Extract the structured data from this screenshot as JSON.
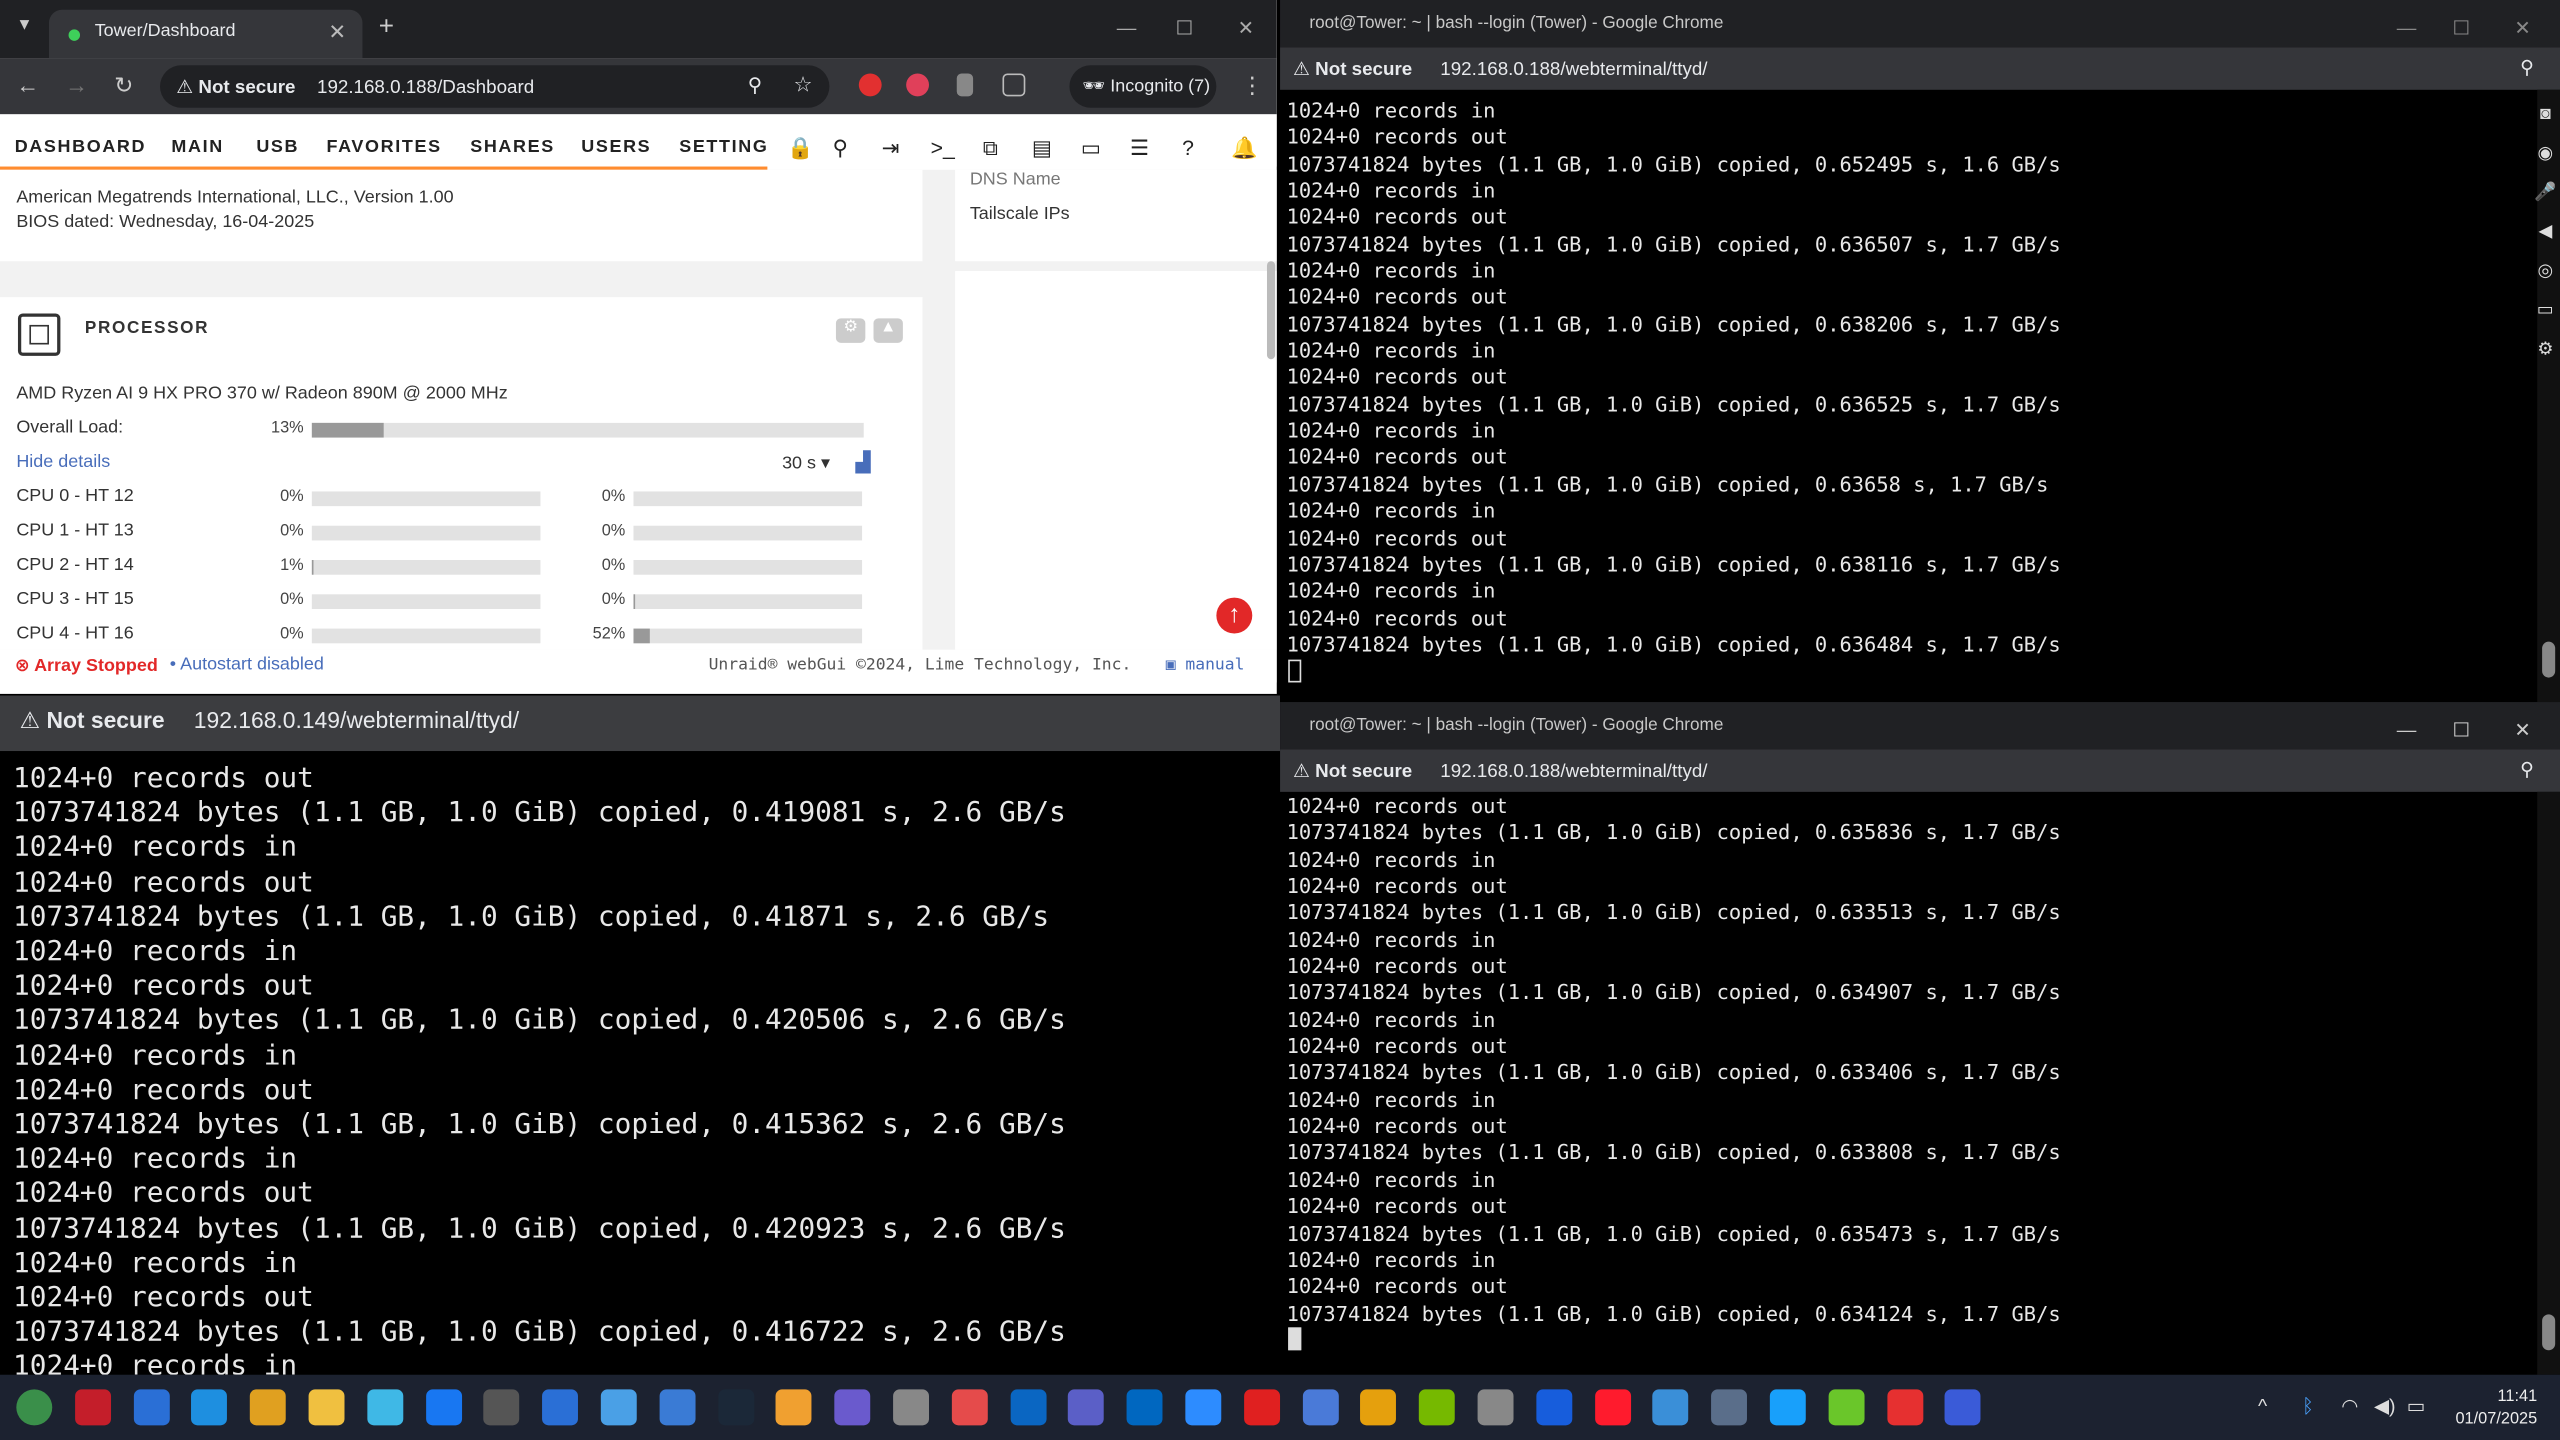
{
  "win1": {
    "tab_title": "Tower/Dashboard",
    "not_secure": "Not secure",
    "url": "192.168.0.188/Dashboard",
    "incognito": "Incognito (7)",
    "nav": [
      "DASHBOARD",
      "MAIN",
      "USB",
      "FAVORITES",
      "SHARES",
      "USERS",
      "SETTING"
    ],
    "bios_line1": "American Megatrends International, LLC., Version 1.00",
    "bios_line2": "BIOS dated: Wednesday, 16-04-2025",
    "right_dns": "DNS Name",
    "right_tailscale": "Tailscale IPs",
    "processor_title": "PROCESSOR",
    "cpu_model": "AMD Ryzen AI 9 HX PRO 370 w/ Radeon 890M @ 2000 MHz",
    "overall_label": "Overall Load:",
    "overall_pct": "13%",
    "overall_value": 0.13,
    "hide_details": "Hide details",
    "interval": "30 s ▾",
    "cpus": [
      {
        "label": "CPU 0 - HT 12",
        "a": "0%",
        "av": 0,
        "b": "0%",
        "bv": 0
      },
      {
        "label": "CPU 1 - HT 13",
        "a": "0%",
        "av": 0,
        "b": "0%",
        "bv": 0
      },
      {
        "label": "CPU 2 - HT 14",
        "a": "1%",
        "av": 0.01,
        "b": "0%",
        "bv": 0
      },
      {
        "label": "CPU 3 - HT 15",
        "a": "0%",
        "av": 0,
        "b": "0%",
        "bv": 0.01
      },
      {
        "label": "CPU 4 - HT 16",
        "a": "0%",
        "av": 0,
        "b": "52%",
        "bv": 0.07
      }
    ],
    "array_status": "Array Stopped",
    "autostart": "Autostart disabled",
    "copyright": "Unraid® webGui ©2024, Lime Technology, Inc.",
    "manual": "manual"
  },
  "win2": {
    "title": "root@Tower: ~ | bash --login (Tower) - Google Chrome",
    "not_secure": "Not secure",
    "url": "192.168.0.188/webterminal/ttyd/",
    "lines": [
      "1024+0 records in",
      "1024+0 records out",
      "1073741824 bytes (1.1 GB, 1.0 GiB) copied, 0.652495 s, 1.6 GB/s",
      "1024+0 records in",
      "1024+0 records out",
      "1073741824 bytes (1.1 GB, 1.0 GiB) copied, 0.636507 s, 1.7 GB/s",
      "1024+0 records in",
      "1024+0 records out",
      "1073741824 bytes (1.1 GB, 1.0 GiB) copied, 0.638206 s, 1.7 GB/s",
      "1024+0 records in",
      "1024+0 records out",
      "1073741824 bytes (1.1 GB, 1.0 GiB) copied, 0.636525 s, 1.7 GB/s",
      "1024+0 records in",
      "1024+0 records out",
      "1073741824 bytes (1.1 GB, 1.0 GiB) copied, 0.63658 s, 1.7 GB/s",
      "1024+0 records in",
      "1024+0 records out",
      "1073741824 bytes (1.1 GB, 1.0 GiB) copied, 0.638116 s, 1.7 GB/s",
      "1024+0 records in",
      "1024+0 records out",
      "1073741824 bytes (1.1 GB, 1.0 GiB) copied, 0.636484 s, 1.7 GB/s"
    ]
  },
  "win3": {
    "not_secure": "Not secure",
    "url": "192.168.0.149/webterminal/ttyd/",
    "lines": [
      "1024+0 records out",
      "1073741824 bytes (1.1 GB, 1.0 GiB) copied, 0.419081 s, 2.6 GB/s",
      "1024+0 records in",
      "1024+0 records out",
      "1073741824 bytes (1.1 GB, 1.0 GiB) copied, 0.41871 s, 2.6 GB/s",
      "1024+0 records in",
      "1024+0 records out",
      "1073741824 bytes (1.1 GB, 1.0 GiB) copied, 0.420506 s, 2.6 GB/s",
      "1024+0 records in",
      "1024+0 records out",
      "1073741824 bytes (1.1 GB, 1.0 GiB) copied, 0.415362 s, 2.6 GB/s",
      "1024+0 records in",
      "1024+0 records out",
      "1073741824 bytes (1.1 GB, 1.0 GiB) copied, 0.420923 s, 2.6 GB/s",
      "1024+0 records in",
      "1024+0 records out",
      "1073741824 bytes (1.1 GB, 1.0 GiB) copied, 0.416722 s, 2.6 GB/s",
      "1024+0 records in"
    ]
  },
  "win4": {
    "title": "root@Tower: ~ | bash --login (Tower) - Google Chrome",
    "not_secure": "Not secure",
    "url": "192.168.0.188/webterminal/ttyd/",
    "lines": [
      "1024+0 records out",
      "1073741824 bytes (1.1 GB, 1.0 GiB) copied, 0.635836 s, 1.7 GB/s",
      "1024+0 records in",
      "1024+0 records out",
      "1073741824 bytes (1.1 GB, 1.0 GiB) copied, 0.633513 s, 1.7 GB/s",
      "1024+0 records in",
      "1024+0 records out",
      "1073741824 bytes (1.1 GB, 1.0 GiB) copied, 0.634907 s, 1.7 GB/s",
      "1024+0 records in",
      "1024+0 records out",
      "1073741824 bytes (1.1 GB, 1.0 GiB) copied, 0.633406 s, 1.7 GB/s",
      "1024+0 records in",
      "1024+0 records out",
      "1073741824 bytes (1.1 GB, 1.0 GiB) copied, 0.633808 s, 1.7 GB/s",
      "1024+0 records in",
      "1024+0 records out",
      "1073741824 bytes (1.1 GB, 1.0 GiB) copied, 0.635473 s, 1.7 GB/s",
      "1024+0 records in",
      "1024+0 records out",
      "1073741824 bytes (1.1 GB, 1.0 GiB) copied, 0.634124 s, 1.7 GB/s"
    ]
  },
  "taskbar": {
    "time": "11:41",
    "date": "01/07/2025",
    "icons": [
      "start",
      "opera-gx",
      "media",
      "edge",
      "chrome",
      "file-explorer",
      "search",
      "teamviewer",
      "terminal",
      "store",
      "remote",
      "photos",
      "steam",
      "notes",
      "virtualbox",
      "sync",
      "calendar",
      "onedrive",
      "teams",
      "u-app",
      "zoom",
      "record",
      "connect",
      "plex",
      "nvidia",
      "usb",
      "bitwarden",
      "opera",
      "monitor",
      "calculator",
      "numbers",
      "minecraft",
      "pdf",
      "remote-app"
    ]
  }
}
